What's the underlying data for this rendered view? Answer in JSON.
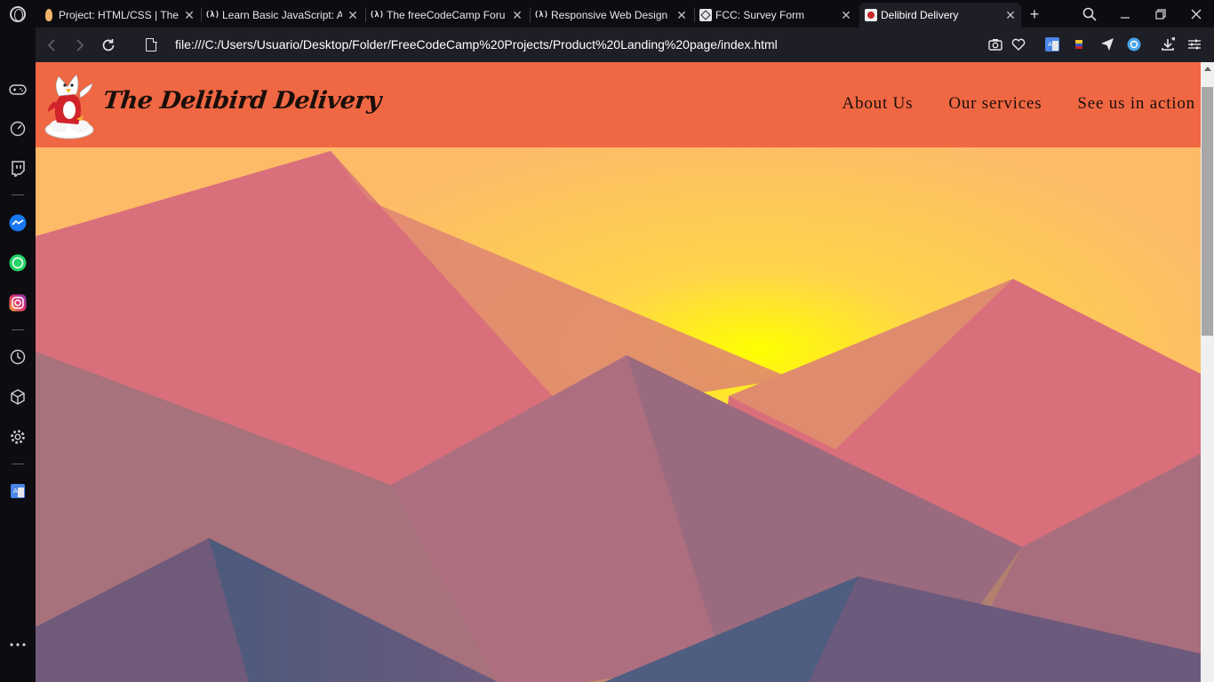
{
  "browser": {
    "tabs": [
      {
        "label": "Project: HTML/CSS | The",
        "favicon": "bunny-icon"
      },
      {
        "label": "Learn Basic JavaScript: A",
        "favicon": "freecodecamp-icon"
      },
      {
        "label": "The freeCodeCamp Foru",
        "favicon": "freecodecamp-icon"
      },
      {
        "label": "Responsive Web Design",
        "favicon": "freecodecamp-icon"
      },
      {
        "label": "FCC: Survey Form",
        "favicon": "survey-icon"
      },
      {
        "label": "Delibird Delivery",
        "favicon": "delibird-icon",
        "active": true
      }
    ],
    "fcc_glyph": "(λ)",
    "url": "file:///C:/Users/Usuario/Desktop/Folder/FreeCodeCamp%20Projects/Product%20Landing%20page/index.html",
    "colors": {
      "chrome_dark": "#0d0d11",
      "address_bar": "#1e1e26",
      "header_bg": "#f06744",
      "sky": "#fdbb68",
      "sun": "#ffff00"
    }
  },
  "sidebar": {
    "icons": [
      "game-controller-icon",
      "speed-dial-icon",
      "twitch-icon",
      "messenger-icon",
      "whatsapp-icon",
      "instagram-icon",
      "history-icon",
      "extensions-icon",
      "settings-icon",
      "translate-icon",
      "more-icon"
    ]
  },
  "site": {
    "title": "The Delibird Delivery",
    "nav": [
      "About Us",
      "Our services",
      "See us in action"
    ]
  }
}
